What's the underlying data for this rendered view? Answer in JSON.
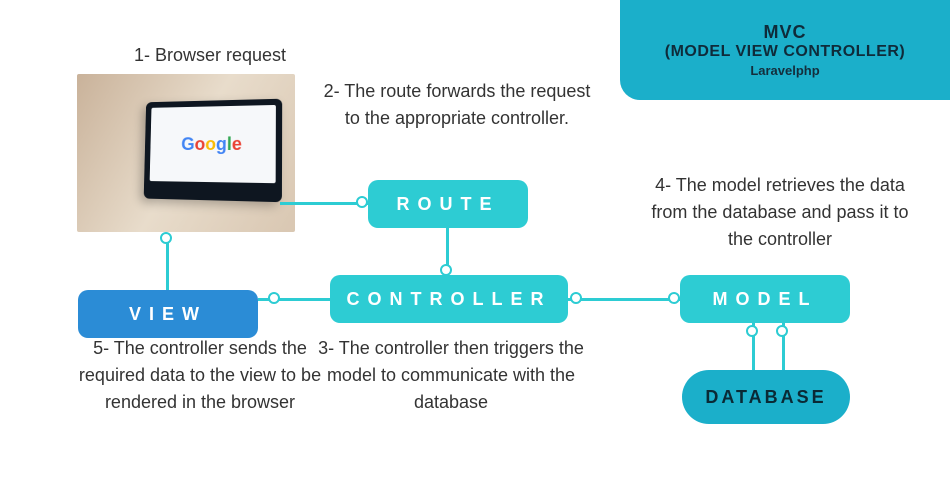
{
  "header": {
    "title": "MVC",
    "subtitle": "(MODEL VIEW CONTROLLER)",
    "author": "Laravelphp"
  },
  "nodes": {
    "route": "ROUTE",
    "controller": "CONTROLLER",
    "model": "MODEL",
    "view": "VIEW",
    "database": "DATABASE"
  },
  "steps": {
    "s1": "1- Browser request",
    "s2": "2- The route forwards the request to the appropriate controller.",
    "s3": "3- The controller then triggers the model to communicate with the database",
    "s4": "4- The model retrieves the data from the database and pass it to the controller",
    "s5": "5- The controller sends the required data to the view to be rendered in the browser"
  },
  "browser_logo": "Google"
}
